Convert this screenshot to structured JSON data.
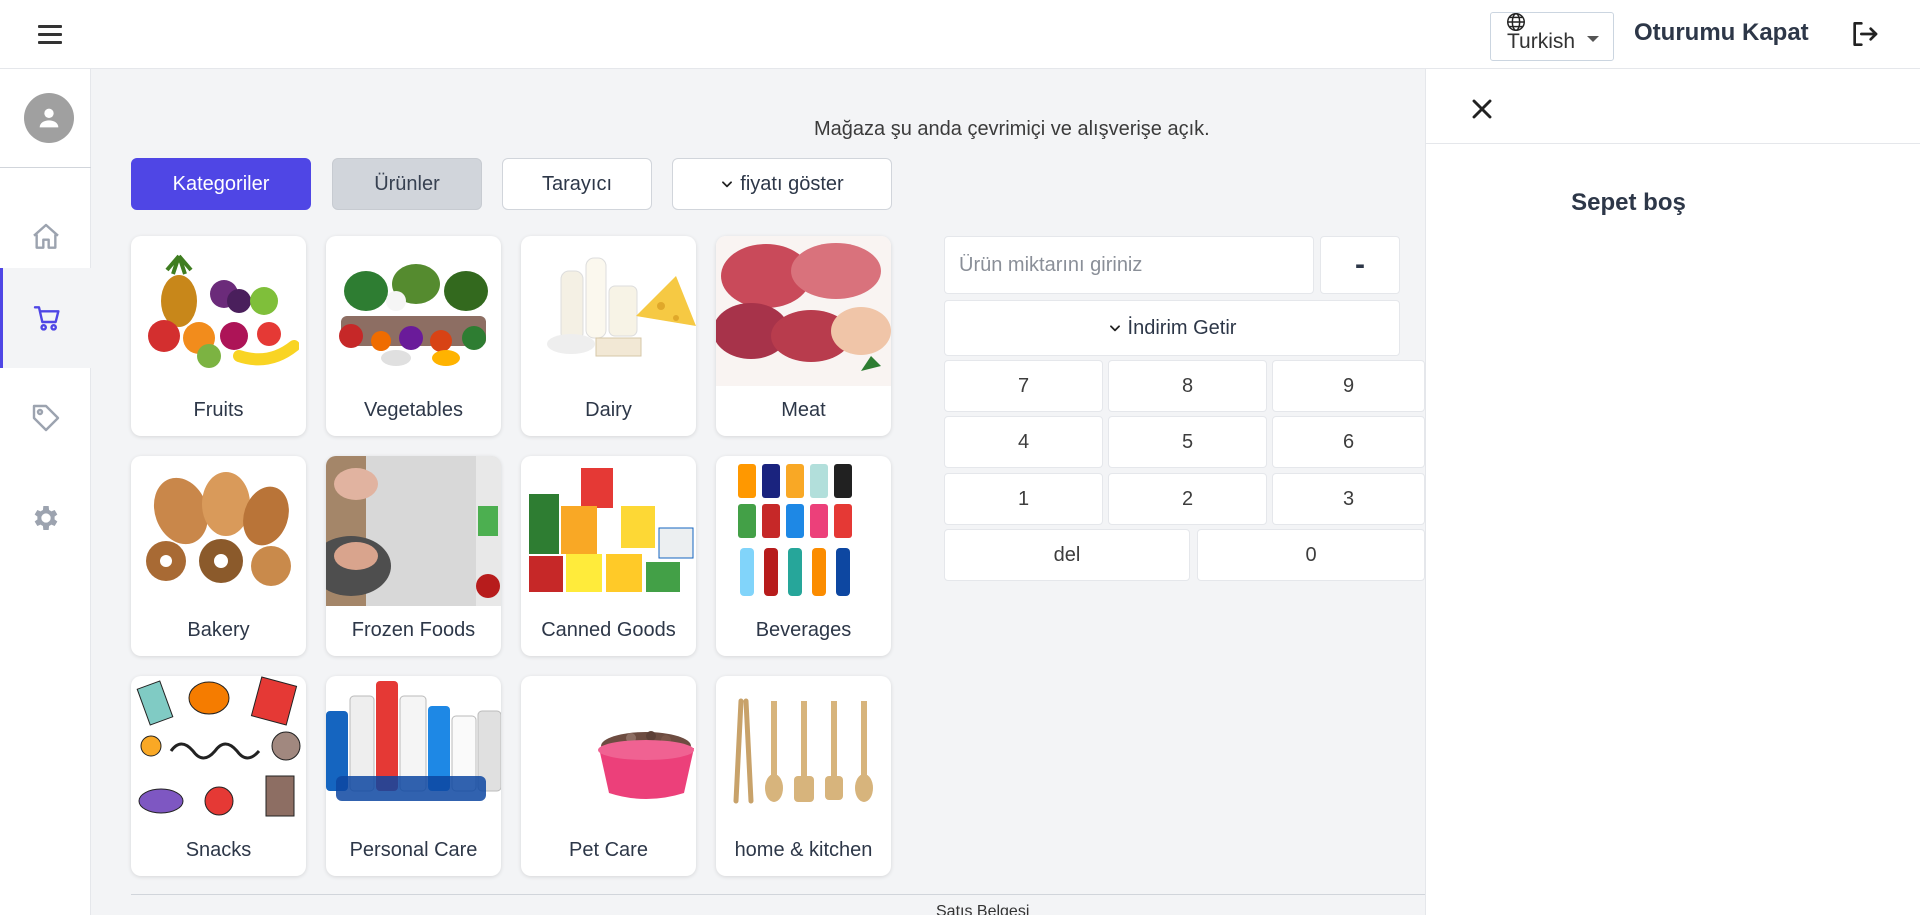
{
  "header": {
    "language": "Turkish",
    "logout_label": "Oturumu Kapat"
  },
  "sidebar": {
    "items": [
      {
        "name": "home",
        "icon": "home-icon"
      },
      {
        "name": "cart",
        "icon": "cart-icon",
        "active": true
      },
      {
        "name": "tags",
        "icon": "tag-icon"
      },
      {
        "name": "settings",
        "icon": "gear-icon"
      }
    ]
  },
  "main": {
    "status_text": "Mağaza şu anda çevrimiçi ve alışverişe açık.",
    "tabs": [
      {
        "label": "Kategoriler",
        "state": "active"
      },
      {
        "label": "Ürünler",
        "state": "selected"
      },
      {
        "label": "Tarayıcı",
        "state": "default"
      },
      {
        "label": "fiyatı göster",
        "state": "dropdown"
      }
    ],
    "categories": [
      {
        "label": "Fruits"
      },
      {
        "label": "Vegetables"
      },
      {
        "label": "Dairy"
      },
      {
        "label": "Meat"
      },
      {
        "label": "Bakery"
      },
      {
        "label": "Frozen Foods"
      },
      {
        "label": "Canned Goods"
      },
      {
        "label": "Beverages"
      },
      {
        "label": "Snacks"
      },
      {
        "label": "Personal Care"
      },
      {
        "label": "Pet Care"
      },
      {
        "label": "home & kitchen"
      }
    ],
    "receipt_label": "Satış Belgesi"
  },
  "keypad": {
    "qty_placeholder": "Ürün miktarını giriniz",
    "minus_label": "-",
    "discount_label": "İndirim Getir",
    "keys": [
      "7",
      "8",
      "9",
      "4",
      "5",
      "6",
      "1",
      "2",
      "3",
      "del",
      "0"
    ]
  },
  "cart": {
    "empty_text": "Sepet boş"
  },
  "colors": {
    "accent": "#4f46e5",
    "secondary_tab": "#d1d5db",
    "background": "#f3f4f6"
  }
}
